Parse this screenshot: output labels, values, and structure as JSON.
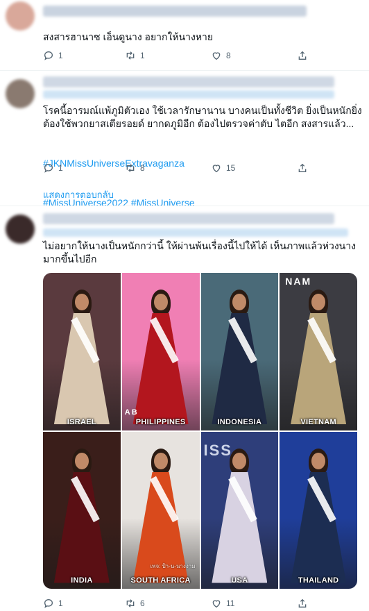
{
  "tweets": [
    {
      "text": "สงสารฮานาซ เอ็นดูนาง อยากให้นางหาย",
      "replies": "1",
      "retweets": "1",
      "likes": "8"
    },
    {
      "text": "โรคนี้อารมณ์แพ้ภูมิตัวเอง ใช้เวลารักษานาน บางคนเป็นทั้งชีวิต ยิ่งเป็นหนักยิ่งต้องใช้พวกยาสเตียรอยด์ ยากดภูมิอีก ต้องไปตรวจค่าตับ ไตอีก สงสารแล้ว...",
      "hashtags": [
        "#JKNMissUniverseExtravaganza",
        "#MissUniverse2022 #MissUniverse"
      ],
      "replies": "1",
      "retweets": "8",
      "likes": "15"
    },
    {
      "text": "ไม่อยากให้นางเป็นหนักกว่านี้ ให้ผ่านพ้นเรื่องนี้ไปให้ได้ เห็นภาพแล้วห่วงนางมากขึ้นไปอีก",
      "replies": "1",
      "retweets": "6",
      "likes": "11"
    }
  ],
  "show_replies": "แสดงการตอบกลับ",
  "photo_grid": {
    "cells": [
      {
        "country": "ISRAEL",
        "bg": "#5a3a3e",
        "gown": "#d9c7b0"
      },
      {
        "country": "PHILIPPINES",
        "bg": "#f07fb4",
        "gown": "#b3161e",
        "logo": "AB"
      },
      {
        "country": "INDONESIA",
        "bg": "#4a6a78",
        "gown": "#1f2a44"
      },
      {
        "country": "VIETNAM",
        "bg": "#3c3c42",
        "gown": "#b9a57a",
        "logo": "NAM"
      },
      {
        "country": "INDIA",
        "bg": "#3a1e1a",
        "gown": "#5a0f14"
      },
      {
        "country": "SOUTH AFRICA",
        "bg": "#e7e3df",
        "gown": "#d94a1c",
        "caption": "เพจ: ป้า-น-นางงาม"
      },
      {
        "country": "USA",
        "bg": "#2e3e7a",
        "gown": "#d8d2e2",
        "logo": "ISS"
      },
      {
        "country": "THAILAND",
        "bg": "#1f3e9a",
        "gown": "#1c2d52"
      }
    ]
  },
  "icons": {
    "reply": "reply-icon",
    "retweet": "retweet-icon",
    "like": "heart-icon",
    "share": "share-icon"
  },
  "colors": {
    "accent": "#1d9bf0",
    "muted": "#536471"
  }
}
